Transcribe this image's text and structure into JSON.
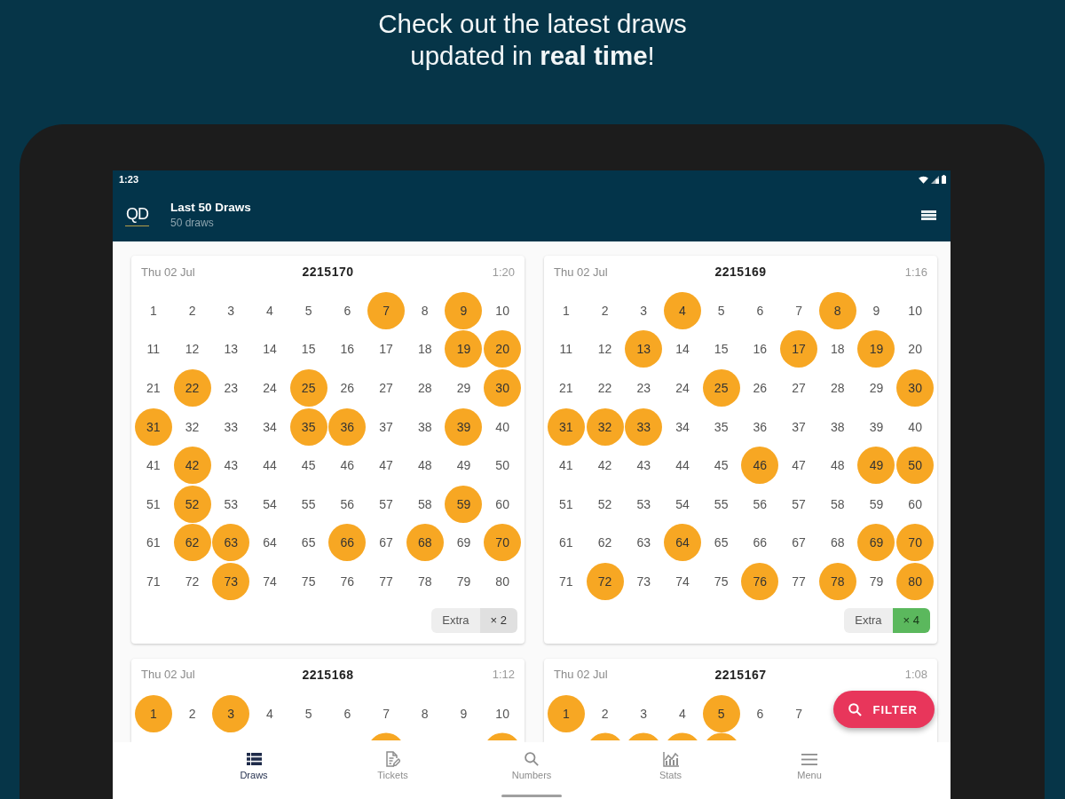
{
  "headline": [
    "Check out the latest draws",
    "updated in **real time**!"
  ],
  "status_bar": {
    "time": "1:23"
  },
  "app_bar": {
    "logo": "QD",
    "title": "Last 50 Draws",
    "subtitle": "50 draws"
  },
  "cards": [
    {
      "date": "Thu 02 Jul",
      "draw": "2215170",
      "time": "1:20",
      "numbers": [
        {
          "n": "1",
          "drawn": false
        },
        {
          "n": "2",
          "drawn": false
        },
        {
          "n": "3",
          "drawn": false
        },
        {
          "n": "4",
          "drawn": false
        },
        {
          "n": "5",
          "drawn": false
        },
        {
          "n": "6",
          "drawn": false
        },
        {
          "n": "7",
          "drawn": true
        },
        {
          "n": "8",
          "drawn": false
        },
        {
          "n": "9",
          "drawn": true
        },
        {
          "n": "10",
          "drawn": false
        },
        {
          "n": "11",
          "drawn": false
        },
        {
          "n": "12",
          "drawn": false
        },
        {
          "n": "13",
          "drawn": false
        },
        {
          "n": "14",
          "drawn": false
        },
        {
          "n": "15",
          "drawn": false
        },
        {
          "n": "16",
          "drawn": false
        },
        {
          "n": "17",
          "drawn": false
        },
        {
          "n": "18",
          "drawn": false
        },
        {
          "n": "19",
          "drawn": true
        },
        {
          "n": "20",
          "drawn": true
        },
        {
          "n": "21",
          "drawn": false
        },
        {
          "n": "22",
          "drawn": true
        },
        {
          "n": "23",
          "drawn": false
        },
        {
          "n": "24",
          "drawn": false
        },
        {
          "n": "25",
          "drawn": true
        },
        {
          "n": "26",
          "drawn": false
        },
        {
          "n": "27",
          "drawn": false
        },
        {
          "n": "28",
          "drawn": false
        },
        {
          "n": "29",
          "drawn": false
        },
        {
          "n": "30",
          "drawn": true
        },
        {
          "n": "31",
          "drawn": true
        },
        {
          "n": "32",
          "drawn": false
        },
        {
          "n": "33",
          "drawn": false
        },
        {
          "n": "34",
          "drawn": false
        },
        {
          "n": "35",
          "drawn": true
        },
        {
          "n": "36",
          "drawn": true
        },
        {
          "n": "37",
          "drawn": false
        },
        {
          "n": "38",
          "drawn": false
        },
        {
          "n": "39",
          "drawn": true
        },
        {
          "n": "40",
          "drawn": false
        },
        {
          "n": "41",
          "drawn": false
        },
        {
          "n": "42",
          "drawn": true
        },
        {
          "n": "43",
          "drawn": false
        },
        {
          "n": "44",
          "drawn": false
        },
        {
          "n": "45",
          "drawn": false
        },
        {
          "n": "46",
          "drawn": false
        },
        {
          "n": "47",
          "drawn": false
        },
        {
          "n": "48",
          "drawn": false
        },
        {
          "n": "49",
          "drawn": false
        },
        {
          "n": "50",
          "drawn": false
        },
        {
          "n": "51",
          "drawn": false
        },
        {
          "n": "52",
          "drawn": true
        },
        {
          "n": "53",
          "drawn": false
        },
        {
          "n": "54",
          "drawn": false
        },
        {
          "n": "55",
          "drawn": false
        },
        {
          "n": "56",
          "drawn": false
        },
        {
          "n": "57",
          "drawn": false
        },
        {
          "n": "58",
          "drawn": false
        },
        {
          "n": "59",
          "drawn": true
        },
        {
          "n": "60",
          "drawn": false
        },
        {
          "n": "61",
          "drawn": false
        },
        {
          "n": "62",
          "drawn": true
        },
        {
          "n": "63",
          "drawn": true
        },
        {
          "n": "64",
          "drawn": false
        },
        {
          "n": "65",
          "drawn": false
        },
        {
          "n": "66",
          "drawn": true
        },
        {
          "n": "67",
          "drawn": false
        },
        {
          "n": "68",
          "drawn": true
        },
        {
          "n": "69",
          "drawn": false
        },
        {
          "n": "70",
          "drawn": true
        },
        {
          "n": "71",
          "drawn": false
        },
        {
          "n": "72",
          "drawn": false
        },
        {
          "n": "73",
          "drawn": true
        },
        {
          "n": "74",
          "drawn": false
        },
        {
          "n": "75",
          "drawn": false
        },
        {
          "n": "76",
          "drawn": false
        },
        {
          "n": "77",
          "drawn": false
        },
        {
          "n": "78",
          "drawn": false
        },
        {
          "n": "79",
          "drawn": false
        },
        {
          "n": "80",
          "drawn": false
        }
      ],
      "extra": {
        "label": "Extra",
        "value": "× 2",
        "highlighted": false
      }
    },
    {
      "date": "Thu 02 Jul",
      "draw": "2215169",
      "time": "1:16",
      "numbers": [
        {
          "n": "1",
          "drawn": false
        },
        {
          "n": "2",
          "drawn": false
        },
        {
          "n": "3",
          "drawn": false
        },
        {
          "n": "4",
          "drawn": true
        },
        {
          "n": "5",
          "drawn": false
        },
        {
          "n": "6",
          "drawn": false
        },
        {
          "n": "7",
          "drawn": false
        },
        {
          "n": "8",
          "drawn": true
        },
        {
          "n": "9",
          "drawn": false
        },
        {
          "n": "10",
          "drawn": false
        },
        {
          "n": "11",
          "drawn": false
        },
        {
          "n": "12",
          "drawn": false
        },
        {
          "n": "13",
          "drawn": true
        },
        {
          "n": "14",
          "drawn": false
        },
        {
          "n": "15",
          "drawn": false
        },
        {
          "n": "16",
          "drawn": false
        },
        {
          "n": "17",
          "drawn": true
        },
        {
          "n": "18",
          "drawn": false
        },
        {
          "n": "19",
          "drawn": true
        },
        {
          "n": "20",
          "drawn": false
        },
        {
          "n": "21",
          "drawn": false
        },
        {
          "n": "22",
          "drawn": false
        },
        {
          "n": "23",
          "drawn": false
        },
        {
          "n": "24",
          "drawn": false
        },
        {
          "n": "25",
          "drawn": true
        },
        {
          "n": "26",
          "drawn": false
        },
        {
          "n": "27",
          "drawn": false
        },
        {
          "n": "28",
          "drawn": false
        },
        {
          "n": "29",
          "drawn": false
        },
        {
          "n": "30",
          "drawn": true
        },
        {
          "n": "31",
          "drawn": true
        },
        {
          "n": "32",
          "drawn": true
        },
        {
          "n": "33",
          "drawn": true
        },
        {
          "n": "34",
          "drawn": false
        },
        {
          "n": "35",
          "drawn": false
        },
        {
          "n": "36",
          "drawn": false
        },
        {
          "n": "37",
          "drawn": false
        },
        {
          "n": "38",
          "drawn": false
        },
        {
          "n": "39",
          "drawn": false
        },
        {
          "n": "40",
          "drawn": false
        },
        {
          "n": "41",
          "drawn": false
        },
        {
          "n": "42",
          "drawn": false
        },
        {
          "n": "43",
          "drawn": false
        },
        {
          "n": "44",
          "drawn": false
        },
        {
          "n": "45",
          "drawn": false
        },
        {
          "n": "46",
          "drawn": true
        },
        {
          "n": "47",
          "drawn": false
        },
        {
          "n": "48",
          "drawn": false
        },
        {
          "n": "49",
          "drawn": true
        },
        {
          "n": "50",
          "drawn": true
        },
        {
          "n": "51",
          "drawn": false
        },
        {
          "n": "52",
          "drawn": false
        },
        {
          "n": "53",
          "drawn": false
        },
        {
          "n": "54",
          "drawn": false
        },
        {
          "n": "55",
          "drawn": false
        },
        {
          "n": "56",
          "drawn": false
        },
        {
          "n": "57",
          "drawn": false
        },
        {
          "n": "58",
          "drawn": false
        },
        {
          "n": "59",
          "drawn": false
        },
        {
          "n": "60",
          "drawn": false
        },
        {
          "n": "61",
          "drawn": false
        },
        {
          "n": "62",
          "drawn": false
        },
        {
          "n": "63",
          "drawn": false
        },
        {
          "n": "64",
          "drawn": true
        },
        {
          "n": "65",
          "drawn": false
        },
        {
          "n": "66",
          "drawn": false
        },
        {
          "n": "67",
          "drawn": false
        },
        {
          "n": "68",
          "drawn": false
        },
        {
          "n": "69",
          "drawn": true
        },
        {
          "n": "70",
          "drawn": true
        },
        {
          "n": "71",
          "drawn": false
        },
        {
          "n": "72",
          "drawn": true
        },
        {
          "n": "73",
          "drawn": false
        },
        {
          "n": "74",
          "drawn": false
        },
        {
          "n": "75",
          "drawn": false
        },
        {
          "n": "76",
          "drawn": true
        },
        {
          "n": "77",
          "drawn": false
        },
        {
          "n": "78",
          "drawn": true
        },
        {
          "n": "79",
          "drawn": false
        },
        {
          "n": "80",
          "drawn": true
        }
      ],
      "extra": {
        "label": "Extra",
        "value": "× 4",
        "highlighted": true
      }
    },
    {
      "date": "Thu 02 Jul",
      "draw": "2215168",
      "time": "1:12",
      "numbers": [
        {
          "n": "1",
          "drawn": true
        },
        {
          "n": "2",
          "drawn": false
        },
        {
          "n": "3",
          "drawn": true
        },
        {
          "n": "4",
          "drawn": false
        },
        {
          "n": "5",
          "drawn": false
        },
        {
          "n": "6",
          "drawn": false
        },
        {
          "n": "7",
          "drawn": false
        },
        {
          "n": "8",
          "drawn": false
        },
        {
          "n": "9",
          "drawn": false
        },
        {
          "n": "10",
          "drawn": false
        }
      ],
      "cut_row": [
        {
          "drawn": false
        },
        {
          "drawn": false
        },
        {
          "drawn": false
        },
        {
          "drawn": false
        },
        {
          "drawn": false
        },
        {
          "drawn": false
        },
        {
          "drawn": true
        },
        {
          "drawn": false
        },
        {
          "drawn": false
        },
        {
          "drawn": true
        }
      ]
    },
    {
      "date": "Thu 02 Jul",
      "draw": "2215167",
      "time": "1:08",
      "numbers": [
        {
          "n": "1",
          "drawn": true
        },
        {
          "n": "2",
          "drawn": false
        },
        {
          "n": "3",
          "drawn": false
        },
        {
          "n": "4",
          "drawn": false
        },
        {
          "n": "5",
          "drawn": true
        },
        {
          "n": "6",
          "drawn": false
        },
        {
          "n": "7",
          "drawn": false
        }
      ],
      "cut_row": [
        {
          "drawn": false
        },
        {
          "drawn": true
        },
        {
          "drawn": true
        },
        {
          "drawn": true
        },
        {
          "drawn": true
        },
        {
          "drawn": false
        },
        {
          "drawn": false
        },
        {
          "drawn": false
        },
        {
          "drawn": false
        },
        {
          "drawn": false
        }
      ]
    }
  ],
  "fab": {
    "label": "FILTER"
  },
  "bottom_nav": [
    {
      "label": "Draws",
      "selected": true
    },
    {
      "label": "Tickets",
      "selected": false
    },
    {
      "label": "Numbers",
      "selected": false
    },
    {
      "label": "Stats",
      "selected": false
    },
    {
      "label": "Menu",
      "selected": false
    }
  ]
}
